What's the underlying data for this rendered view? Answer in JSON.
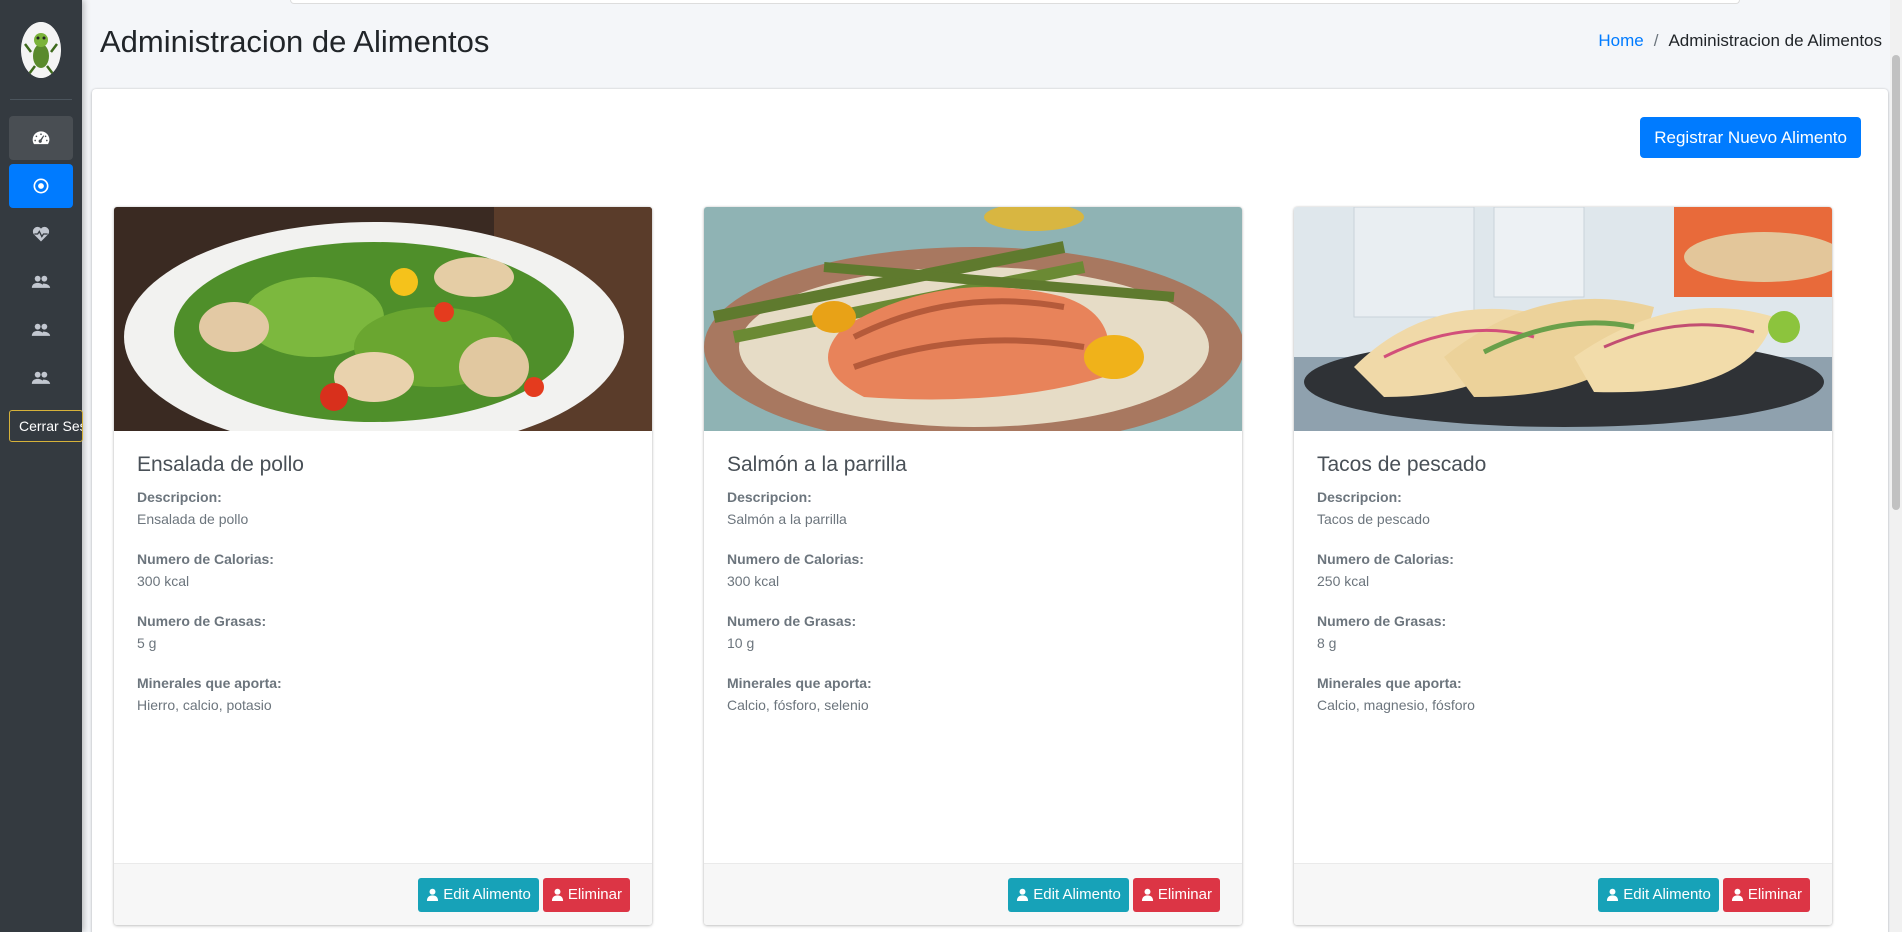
{
  "sidebar": {
    "logout_label": "Cerrar Ses",
    "nav_icons": [
      "dashboard-icon",
      "circle-dot-icon",
      "heartbeat-icon",
      "users-icon",
      "users-icon",
      "users-icon"
    ]
  },
  "header": {
    "title": "Administracion de Alimentos",
    "breadcrumb": {
      "home": "Home",
      "separator": "/",
      "current": "Administracion de Alimentos"
    }
  },
  "main": {
    "register_button": "Registrar Nuevo Alimento",
    "labels": {
      "descripcion": "Descripcion:",
      "calorias": "Numero de Calorias:",
      "grasas": "Numero de Grasas:",
      "minerales": "Minerales que aporta:"
    },
    "cards": [
      {
        "name": "Ensalada de pollo",
        "descripcion": "Ensalada de pollo",
        "calorias": "300 kcal",
        "grasas": "5 g",
        "minerales": "Hierro, calcio, potasio",
        "edit_label": "Edit Alimento",
        "delete_label": "Eliminar"
      },
      {
        "name": "Salmón a la parrilla",
        "descripcion": "Salmón a la parrilla",
        "calorias": "300 kcal",
        "grasas": "10 g",
        "minerales": "Calcio, fósforo, selenio",
        "edit_label": "Edit Alimento",
        "delete_label": "Eliminar"
      },
      {
        "name": "Tacos de pescado",
        "descripcion": "Tacos de pescado",
        "calorias": "250 kcal",
        "grasas": "8 g",
        "minerales": "Calcio, magnesio, fósforo",
        "edit_label": "Edit Alimento",
        "delete_label": "Eliminar"
      }
    ]
  },
  "colors": {
    "primary": "#007bff",
    "info": "#17a2b8",
    "danger": "#dc3545",
    "sidebar": "#343a40"
  }
}
